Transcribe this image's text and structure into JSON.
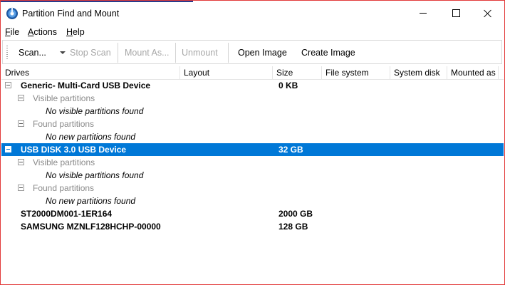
{
  "window": {
    "title": "Partition Find and Mount"
  },
  "menu": [
    {
      "label": "File",
      "ul": "F",
      "rest": "ile"
    },
    {
      "label": "Actions",
      "ul": "A",
      "rest": "ctions"
    },
    {
      "label": "Help",
      "ul": "H",
      "rest": "elp"
    }
  ],
  "toolbar": {
    "scan": "Scan...",
    "stop_scan": "Stop Scan",
    "mount_as": "Mount As...",
    "unmount": "Unmount",
    "open_image": "Open Image",
    "create_image": "Create Image"
  },
  "columns": [
    "Drives",
    "Layout",
    "Size",
    "File system",
    "System disk",
    "Mounted as"
  ],
  "rows": [
    {
      "drive": "Generic- Multi-Card USB Device",
      "size": "0 KB"
    },
    {
      "text": "Visible partitions"
    },
    {
      "text": "No visible partitions found"
    },
    {
      "text": "Found partitions"
    },
    {
      "text": "No new partitions found"
    },
    {
      "drive": "USB DISK 3.0 USB Device",
      "size": "32 GB",
      "selected": true
    },
    {
      "text": "Visible partitions"
    },
    {
      "text": "No visible partitions found"
    },
    {
      "text": "Found partitions"
    },
    {
      "text": "No new partitions found"
    },
    {
      "drive": "ST2000DM001-1ER164",
      "size": "2000 GB"
    },
    {
      "drive": "SAMSUNG MZNLF128HCHP-00000",
      "size": "128 GB"
    }
  ],
  "colors": {
    "selection": "#0078d7",
    "disabled_text": "#a7a7a7",
    "window_border": "#e23a3a"
  }
}
